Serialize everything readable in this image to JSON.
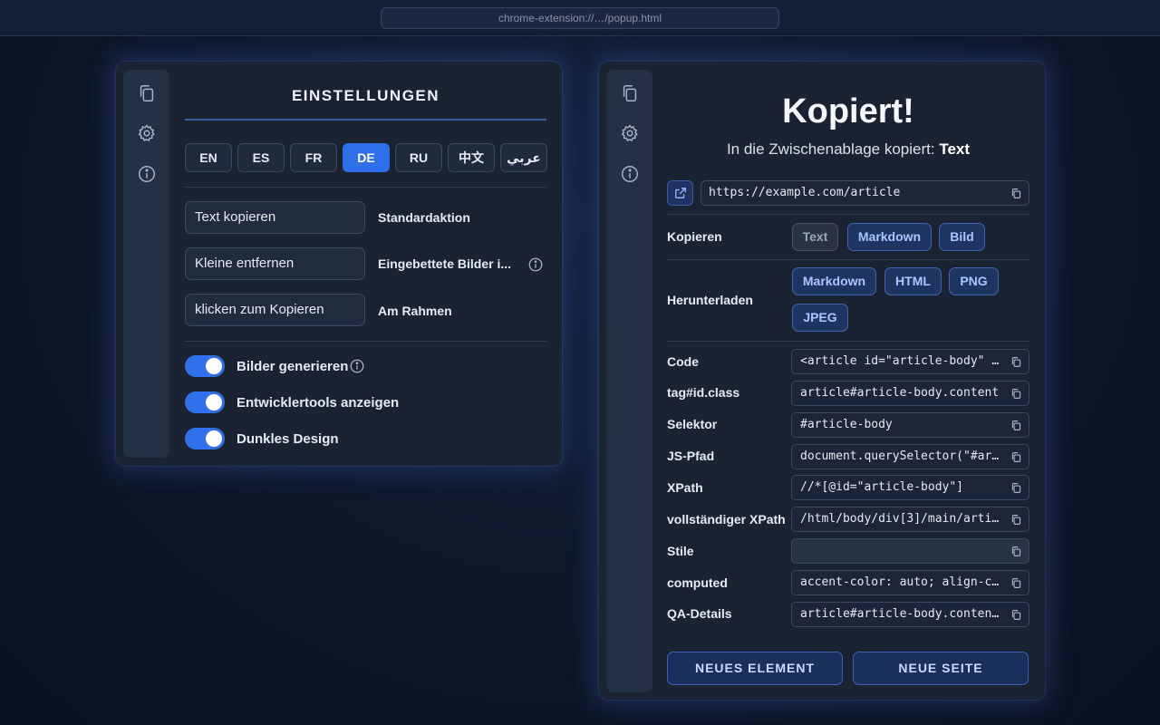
{
  "browser": {
    "url": "chrome-extension://…/popup.html"
  },
  "rail_icons": [
    "copy-icon",
    "gear-icon",
    "info-icon"
  ],
  "settings": {
    "title": "EINSTELLUNGEN",
    "languages": [
      "EN",
      "ES",
      "FR",
      "DE",
      "RU",
      "中文",
      "عربي"
    ],
    "active_language": "DE",
    "selects": [
      {
        "value": "Text kopieren",
        "label": "Standardaktion"
      },
      {
        "value": "Kleine entfernen",
        "label": "Eingebettete Bilder i..."
      },
      {
        "value": "klicken zum Kopieren",
        "label": "Am Rahmen"
      }
    ],
    "toggles": [
      {
        "label": "Bilder generieren",
        "on": true
      },
      {
        "label": "Entwicklertools anzeigen",
        "on": true
      },
      {
        "label": "Dunkles Design",
        "on": true
      }
    ]
  },
  "result": {
    "heading": "Kopiert!",
    "subheading_prefix": "In die Zwischenablage kopiert:",
    "subheading_value": "Text",
    "url": "https://example.com/article",
    "copy_label": "Kopieren",
    "copy_options": [
      "Text",
      "Markdown",
      "Bild"
    ],
    "download_label": "Herunterladen",
    "download_options": [
      "Markdown",
      "HTML",
      "PNG",
      "JPEG"
    ],
    "fields": [
      {
        "label": "Code",
        "value": "<article id=\"article-body\" c..."
      },
      {
        "label": "tag#id.class",
        "value": "article#article-body.content"
      },
      {
        "label": "Selektor",
        "value": "#article-body"
      },
      {
        "label": "JS-Pfad",
        "value": "document.querySelector(\"#art..."
      },
      {
        "label": "XPath",
        "value": "//*[@id=\"article-body\"]"
      },
      {
        "label": "vollständiger XPath",
        "value": "/html/body/div[3]/main/artic..."
      },
      {
        "label": "Stile",
        "value": ""
      },
      {
        "label": "computed",
        "value": "accent-color: auto; align-co..."
      },
      {
        "label": "QA-Details",
        "value": "article#article-body.content..."
      }
    ],
    "new_element_button": "NEUES ELEMENT",
    "new_page_button": "NEUE SEITE"
  }
}
